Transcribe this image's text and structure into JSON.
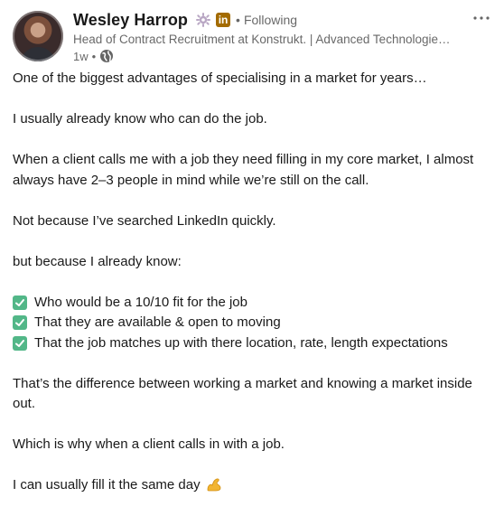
{
  "author": {
    "name": "Wesley Harrop",
    "following_label": "Following",
    "headline": "Head of Contract Recruitment at Konstrukt. | Advanced Technologies & Complex Infrastructure",
    "time_ago": "1w",
    "visibility_icon": "globe-icon"
  },
  "icons": {
    "badge": "gear-icon",
    "linkedin": "linkedin-icon",
    "more": "more-icon",
    "check": "check-icon",
    "arm": "flexed-biceps-icon"
  },
  "post": {
    "p1": "One of the biggest advantages of specialising in a market for years…",
    "p2": "I usually already know who can do the job.",
    "p3": "When a client calls me with a job they need filling in my core market, I almost always have 2–3 people in mind while we’re still on the call.",
    "p4": "Not because I’ve searched LinkedIn quickly.",
    "p5": "but because I already know:",
    "checks": [
      "Who would be a 10/10 fit for the job",
      "That they are available & open to moving",
      "That the job matches up with there location, rate, length expectations"
    ],
    "p6": "That’s the difference between working a market and knowing a market inside out.",
    "p7": "Which is why when a client calls in with a job.",
    "p8": "I can usually fill it the same day"
  },
  "colors": {
    "check_green": "#52b788",
    "badge_gold": "#a36b00",
    "muted_text": "#666666"
  }
}
